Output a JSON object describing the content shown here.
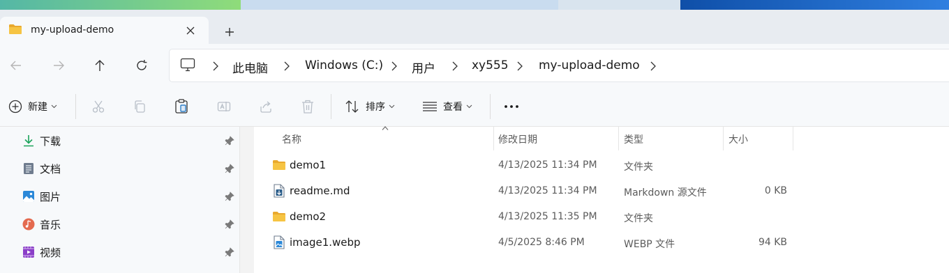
{
  "window": {
    "tab_title": "my-upload-demo",
    "new_tab_label": "+"
  },
  "address": {
    "crumbs": [
      "此电脑",
      "Windows (C:)",
      "用户",
      "xy555",
      "my-upload-demo"
    ]
  },
  "toolbar": {
    "new_label": "新建",
    "sort_label": "排序",
    "view_label": "查看",
    "more_label": "•••"
  },
  "sidebar": {
    "items": [
      {
        "label": "下载",
        "icon": "download-icon"
      },
      {
        "label": "文档",
        "icon": "document-icon"
      },
      {
        "label": "图片",
        "icon": "pictures-icon"
      },
      {
        "label": "音乐",
        "icon": "music-icon"
      },
      {
        "label": "视频",
        "icon": "videos-icon"
      }
    ]
  },
  "files": {
    "headers": {
      "name": "名称",
      "date": "修改日期",
      "type": "类型",
      "size": "大小"
    },
    "rows": [
      {
        "name": "demo1",
        "date": "4/13/2025 11:34 PM",
        "type": "文件夹",
        "size": "",
        "icon": "folder-icon"
      },
      {
        "name": "readme.md",
        "date": "4/13/2025 11:34 PM",
        "type": "Markdown 源文件",
        "size": "0 KB",
        "icon": "markdown-file-icon"
      },
      {
        "name": "demo2",
        "date": "4/13/2025 11:35 PM",
        "type": "文件夹",
        "size": "",
        "icon": "folder-icon"
      },
      {
        "name": "image1.webp",
        "date": "4/5/2025 8:46 PM",
        "type": "WEBP 文件",
        "size": "94 KB",
        "icon": "image-file-icon"
      }
    ]
  },
  "colors": {
    "folder": "#f6c443",
    "accent": "#0f6cbd",
    "pane_bg": "#f7f9fb",
    "tabbar_bg": "#e8ecf1"
  }
}
